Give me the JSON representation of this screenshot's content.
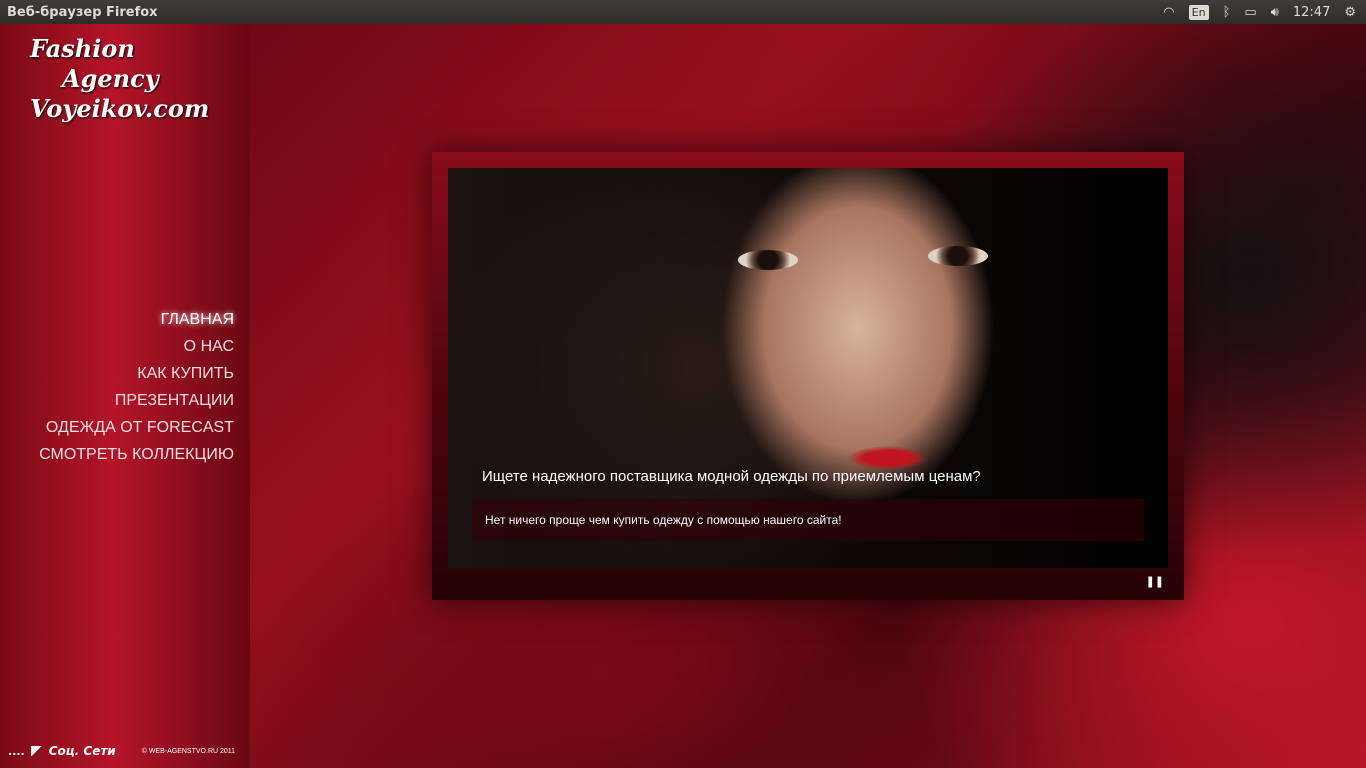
{
  "topbar": {
    "title": "Веб-браузер Firefox",
    "lang": "En",
    "time": "12:47"
  },
  "logo": {
    "line1": "Fashion",
    "line2": "Agency",
    "line3": "Voyeikov.com"
  },
  "nav": [
    {
      "label": "ГЛАВНАЯ",
      "active": true
    },
    {
      "label": "О НАС"
    },
    {
      "label": "КАК КУПИТЬ"
    },
    {
      "label": "ПРЕЗЕНТАЦИИ"
    },
    {
      "label": "ОДЕЖДА ОТ FORECAST"
    },
    {
      "label": "СМОТРЕТЬ КОЛЛЕКЦИЮ"
    }
  ],
  "slider": {
    "heading": "Ищете надежного поставщика модной одежды по приемлемым ценам?",
    "text": "Нет ничего проще чем купить одежду с помощью нашего сайта!",
    "pause": "❚❚"
  },
  "footer": {
    "dots": "....",
    "social": "Соц. Сети",
    "copyright": "© WEB-AGENSTVO.RU 2011"
  }
}
